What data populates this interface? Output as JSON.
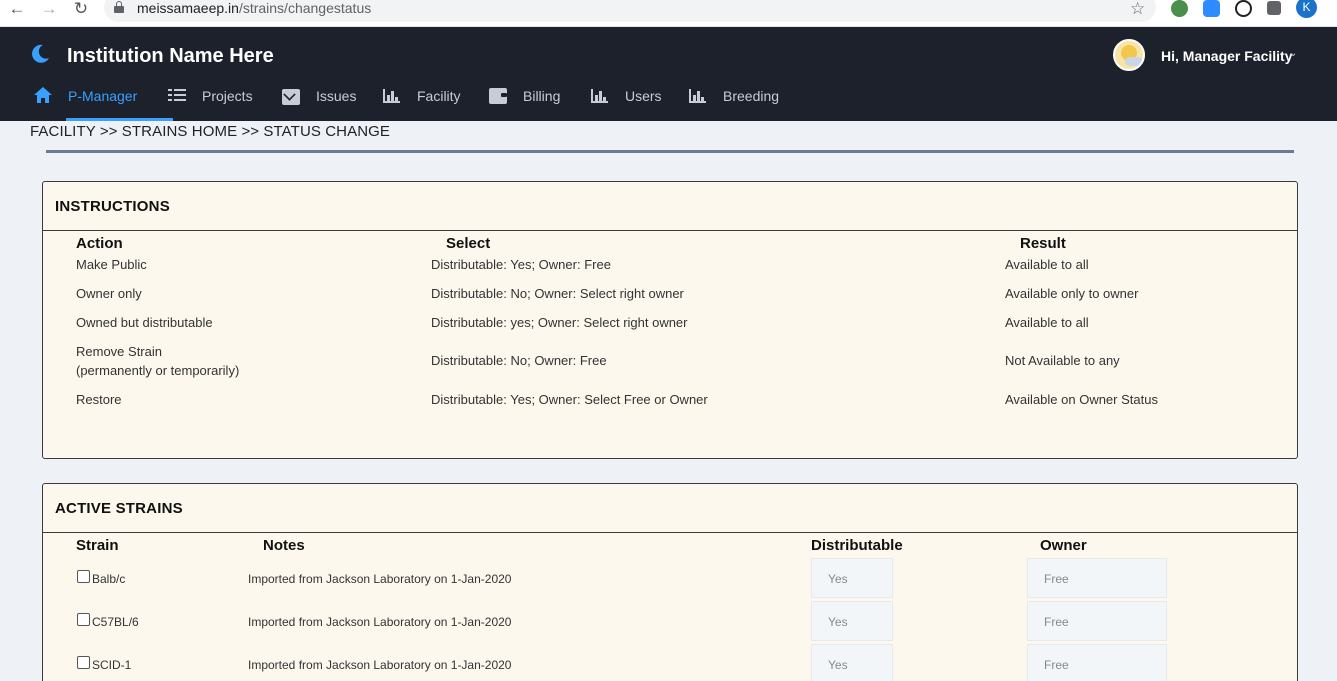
{
  "browser": {
    "url_host": "meissamaeep.in",
    "url_path": "/strains/changestatus",
    "profile_initial": "K"
  },
  "app": {
    "brand": "Institution Name Here",
    "greeting": "Hi, Manager Facility",
    "nav": [
      {
        "label": "P-Manager",
        "icon": "home-icon",
        "active": true
      },
      {
        "label": "Projects",
        "icon": "list-icon"
      },
      {
        "label": "Issues",
        "icon": "envelope-icon"
      },
      {
        "label": "Facility",
        "icon": "chart-icon"
      },
      {
        "label": "Billing",
        "icon": "wallet-icon"
      },
      {
        "label": "Users",
        "icon": "chart-icon"
      },
      {
        "label": "Breeding",
        "icon": "chart-icon"
      }
    ],
    "accent_color": "#3aa0ff",
    "header_bg": "#1c212b"
  },
  "breadcrumb": "FACILITY >> STRAINS HOME >> STATUS CHANGE",
  "instructions": {
    "title": "INSTRUCTIONS",
    "headers": {
      "action": "Action",
      "select": "Select",
      "result": "Result"
    },
    "rows": [
      {
        "action": "Make Public",
        "action2": "",
        "select": "Distributable: Yes; Owner: Free",
        "result": "Available to all"
      },
      {
        "action": "Owner only",
        "action2": "",
        "select": "Distributable: No; Owner: Select right owner",
        "result": "Available only to owner"
      },
      {
        "action": "Owned but distributable",
        "action2": "",
        "select": "Distributable: yes; Owner: Select right owner",
        "result": "Available to all"
      },
      {
        "action": "Remove Strain",
        "action2": "(permanently or temporarily)",
        "select": "Distributable: No; Owner: Free",
        "result": "Not Available to any"
      },
      {
        "action": "Restore",
        "action2": "",
        "select": "Distributable: Yes; Owner: Select Free or Owner",
        "result": "Available on Owner Status"
      }
    ]
  },
  "active_strains": {
    "title": "ACTIVE STRAINS",
    "headers": {
      "strain": "Strain",
      "notes": "Notes",
      "distributable": "Distributable",
      "owner": "Owner"
    },
    "rows": [
      {
        "strain": "Balb/c",
        "notes": "Imported from Jackson Laboratory on 1-Jan-2020",
        "distributable": "Yes",
        "owner": "Free"
      },
      {
        "strain": "C57BL/6",
        "notes": "Imported from Jackson Laboratory on 1-Jan-2020",
        "distributable": "Yes",
        "owner": "Free"
      },
      {
        "strain": "SCID-1",
        "notes": "Imported from Jackson Laboratory on 1-Jan-2020",
        "distributable": "Yes",
        "owner": "Free"
      }
    ]
  }
}
